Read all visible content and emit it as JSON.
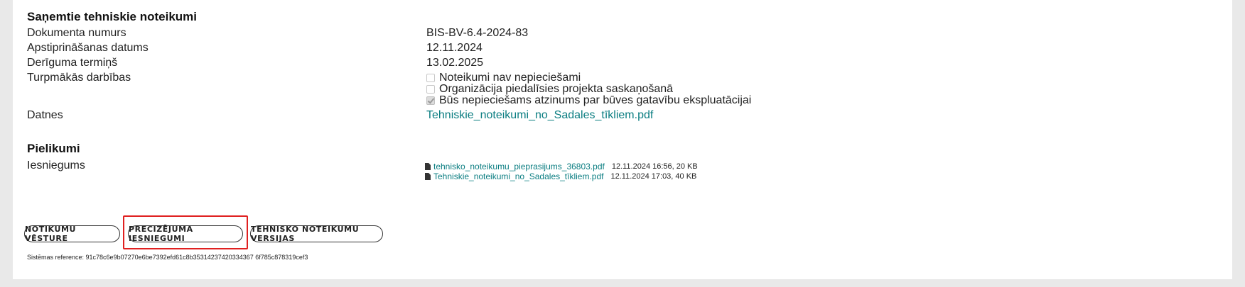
{
  "received": {
    "title": "Saņemtie tehniskie noteikumi",
    "rows": [
      {
        "label": "Dokumenta numurs",
        "value": "BIS-BV-6.4-2024-83"
      },
      {
        "label": "Apstiprināšanas datums",
        "value": "12.11.2024"
      },
      {
        "label": "Derīguma termiņš",
        "value": "13.02.2025"
      }
    ],
    "actions_label": "Turpmākās darbības",
    "actions": [
      {
        "label": "Noteikumi nav nepieciešami",
        "checked": false
      },
      {
        "label": "Organizācija piedalīsies projekta saskaņošanā",
        "checked": false
      },
      {
        "label": "Būs nepieciešams atzinums par būves gatavību ekspluatācijai",
        "checked": true
      }
    ],
    "files_label": "Datnes",
    "file_link": "Tehniskie_noteikumi_no_Sadales_tīkliem.pdf"
  },
  "attachments": {
    "title": "Pielikumi",
    "label": "Iesniegums",
    "items": [
      {
        "name": "tehnisko_noteikumu_pieprasijums_36803.pdf",
        "meta": "12.11.2024 16:56, 20 KB"
      },
      {
        "name": "Tehniskie_noteikumi_no_Sadales_tīkliem.pdf",
        "meta": "12.11.2024 17:03, 40 KB"
      }
    ]
  },
  "buttons": {
    "history": "NOTIKUMU VĒSTURE",
    "clarification": "PRECIZĒJUMA IESNIEGUMI",
    "versions": "TEHNISKO NOTEIKUMU VERSIJAS"
  },
  "system_reference": "Sistēmas reference: 91c78c6e9b07270e6be7392efd61c8b35314237420334367 6f785c878319cef3"
}
